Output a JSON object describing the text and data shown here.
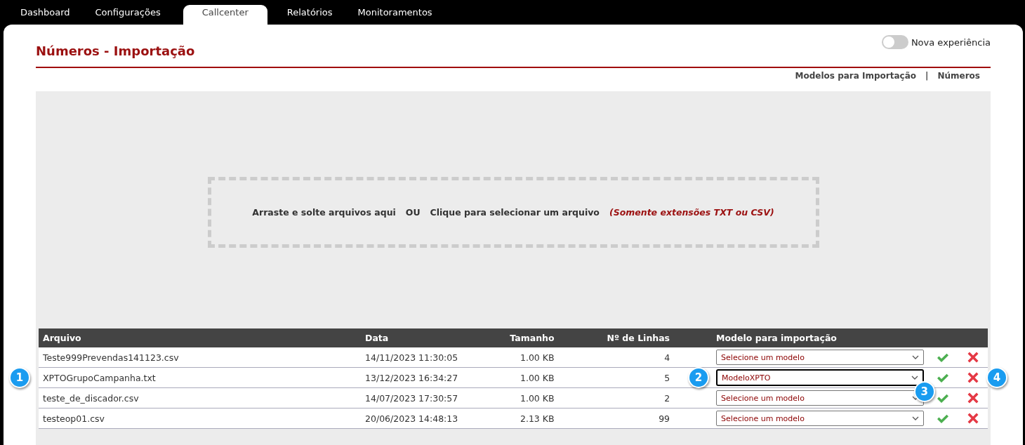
{
  "tabs": [
    {
      "label": "Dashboard",
      "selected": false
    },
    {
      "label": "Configurações",
      "selected": false
    },
    {
      "label": "Callcenter",
      "selected": true
    },
    {
      "label": "Relatórios",
      "selected": false
    },
    {
      "label": "Monitoramentos",
      "selected": false
    }
  ],
  "title": "Números - Importação",
  "toggle": {
    "label": "Nova experiência",
    "on": false
  },
  "links": [
    "Modelos para Importação",
    "|",
    "Números"
  ],
  "dropzone": {
    "drag_text": "Arraste e solte arquivos aqui",
    "or_text": "OU",
    "click_text": "Clique para selecionar um arquivo",
    "note": "(Somente extensões TXT ou CSV)"
  },
  "table": {
    "columns": [
      "Arquivo",
      "Data",
      "Tamanho",
      "Nº de Linhas",
      "Modelo para importação"
    ],
    "rows": [
      {
        "file": "Teste999Prevendas141123.csv",
        "date": "14/11/2023 11:30:05",
        "size": "1.00 KB",
        "lines": "4",
        "model": "Selecione um modelo",
        "focused": false
      },
      {
        "file": "XPTOGrupoCampanha.txt",
        "date": "13/12/2023 16:34:27",
        "size": "1.00 KB",
        "lines": "5",
        "model": "ModeloXPTO",
        "focused": true,
        "callouts": [
          {
            "kind": "file",
            "label": "1"
          },
          {
            "kind": "model",
            "label": "2"
          },
          {
            "kind": "accept",
            "label": "3"
          },
          {
            "kind": "remove",
            "label": "4"
          }
        ]
      },
      {
        "file": "teste_de_discador.csv",
        "date": "14/07/2023 17:30:57",
        "size": "1.00 KB",
        "lines": "2",
        "model": "Selecione um modelo",
        "focused": false
      },
      {
        "file": "testeop01.csv",
        "date": "20/06/2023 14:48:13",
        "size": "2.13 KB",
        "lines": "99",
        "model": "Selecione um modelo",
        "focused": false
      }
    ]
  }
}
